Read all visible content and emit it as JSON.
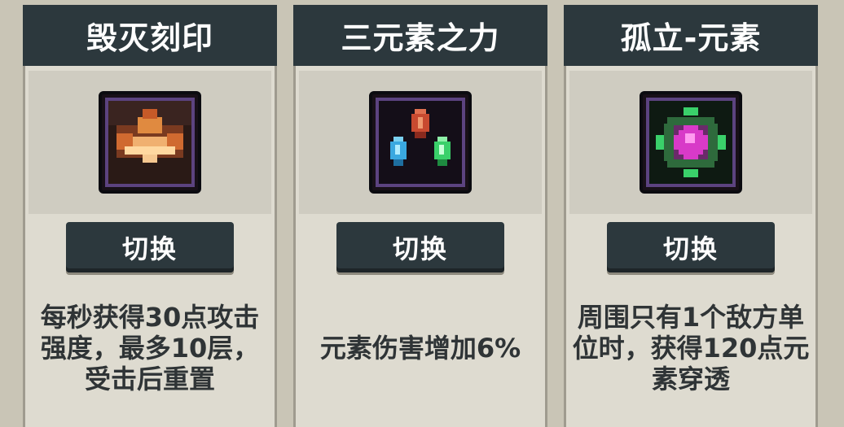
{
  "cards": [
    {
      "title": "毁灭刻印",
      "button": "切换",
      "description": "每秒获得30点攻击强度，最多10层，受击后重置",
      "icon": "flame-mark-icon"
    },
    {
      "title": "三元素之力",
      "button": "切换",
      "description": "元素伤害增加6%",
      "icon": "three-crystals-icon"
    },
    {
      "title": "孤立-元素",
      "button": "切换",
      "description": "周围只有1个敌方单位时，获得120点元素穿透",
      "icon": "element-orb-icon"
    }
  ],
  "colors": {
    "header_bg": "#2c383d",
    "card_bg": "#dedbd0",
    "text_dark": "#2f3436",
    "icon_border": "#5c4380"
  }
}
